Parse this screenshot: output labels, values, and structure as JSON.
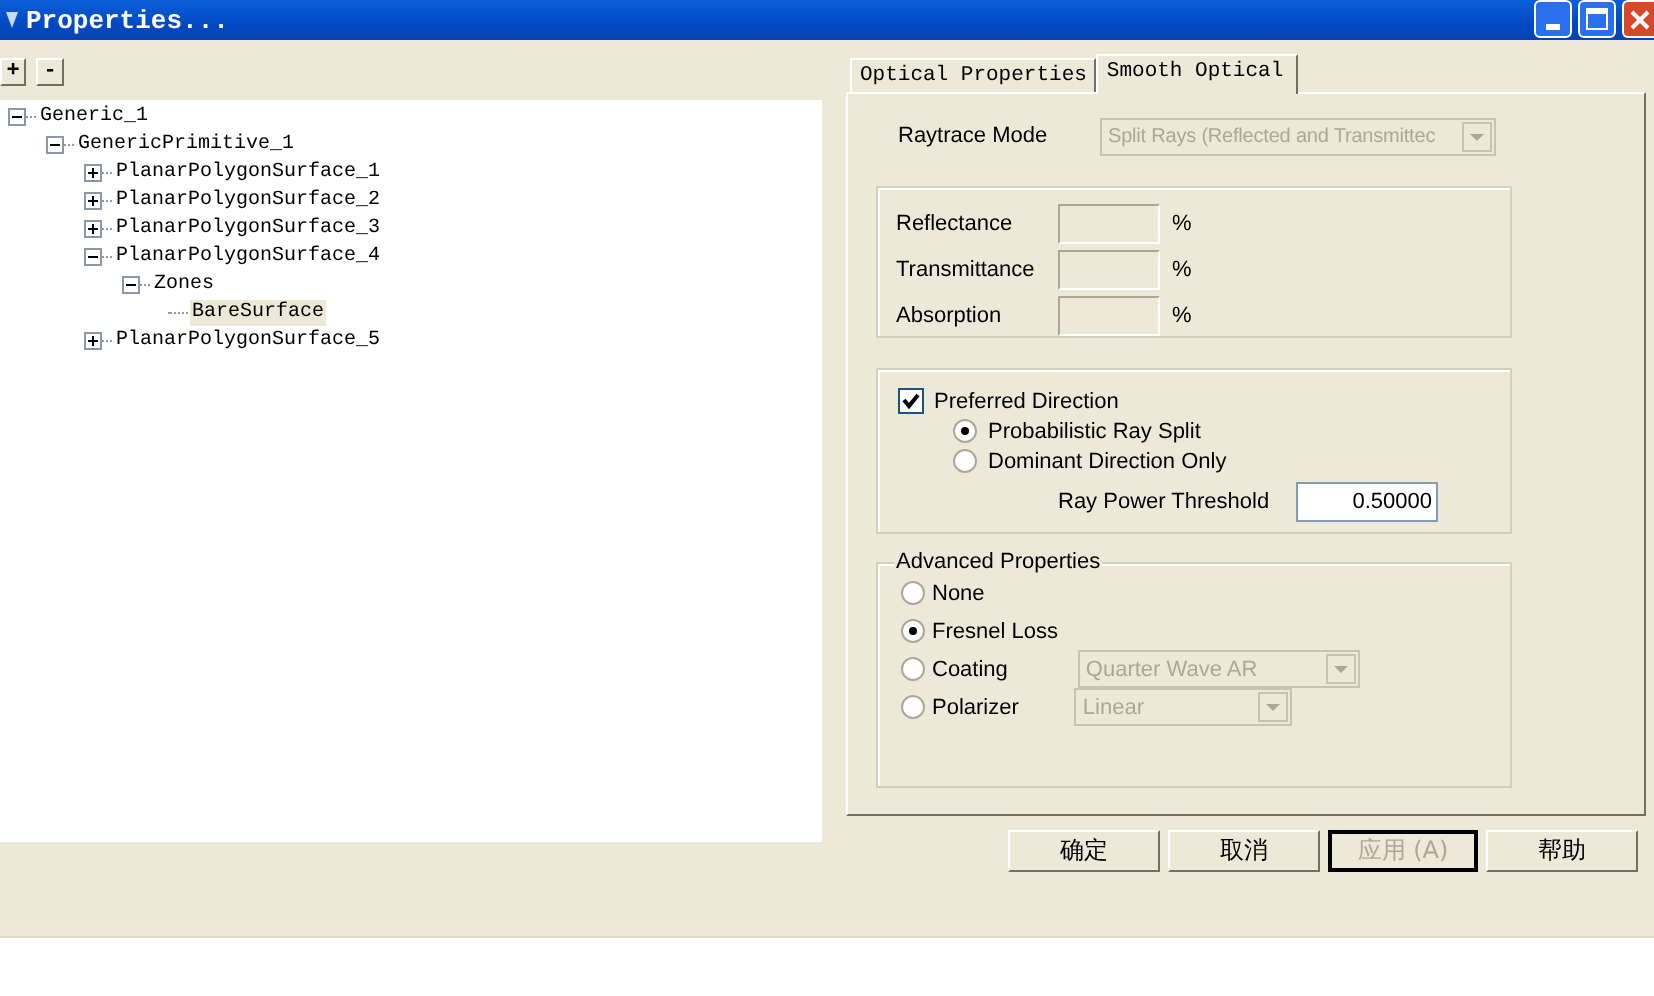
{
  "window": {
    "title": "Properties..."
  },
  "tree_buttons": [
    "+",
    "-"
  ],
  "tree": [
    {
      "label": "Generic_1",
      "kind": "node",
      "expanded": true,
      "selected": false,
      "children": [
        {
          "label": "GenericPrimitive_1",
          "kind": "node",
          "expanded": true,
          "selected": false,
          "children": [
            {
              "label": "PlanarPolygonSurface_1",
              "kind": "node",
              "expanded": false,
              "selected": false
            },
            {
              "label": "PlanarPolygonSurface_2",
              "kind": "node",
              "expanded": false,
              "selected": false
            },
            {
              "label": "PlanarPolygonSurface_3",
              "kind": "node",
              "expanded": false,
              "selected": false
            },
            {
              "label": "PlanarPolygonSurface_4",
              "kind": "node",
              "expanded": true,
              "selected": false,
              "children": [
                {
                  "label": "Zones",
                  "kind": "node",
                  "expanded": true,
                  "selected": false,
                  "children": [
                    {
                      "label": "BareSurface",
                      "kind": "leaf",
                      "selected": true
                    }
                  ]
                }
              ]
            },
            {
              "label": "PlanarPolygonSurface_5",
              "kind": "node",
              "expanded": false,
              "selected": false
            }
          ]
        }
      ]
    }
  ],
  "tabs": [
    {
      "label": "Optical Properties",
      "selected": false
    },
    {
      "label": "Smooth Optical",
      "selected": true
    }
  ],
  "raytrace_mode": {
    "label": "Raytrace Mode",
    "value": "Split Rays (Reflected and Transmittec",
    "disabled": true
  },
  "coefficients": [
    {
      "label": "Reflectance",
      "unit": "%"
    },
    {
      "label": "Transmittance",
      "unit": "%"
    },
    {
      "label": "Absorption",
      "unit": "%"
    }
  ],
  "preferred_direction": {
    "label": "Preferred Direction",
    "checked": true,
    "options": [
      {
        "label": "Probabilistic Ray Split",
        "selected": true
      },
      {
        "label": "Dominant Direction Only",
        "selected": false
      }
    ],
    "threshold": {
      "label": "Ray Power Threshold",
      "value": "0.50000"
    }
  },
  "advanced": {
    "title": "Advanced Properties",
    "options": [
      {
        "label": "None",
        "selected": false
      },
      {
        "label": "Fresnel Loss",
        "selected": true
      },
      {
        "label": "Coating",
        "selected": false,
        "dropdown": {
          "value": "Quarter Wave AR",
          "disabled": true
        }
      },
      {
        "label": "Polarizer",
        "selected": false,
        "dropdown": {
          "value": "Linear",
          "disabled": true
        }
      }
    ]
  },
  "buttons": [
    {
      "label": "确定",
      "disabled": false,
      "focused": false
    },
    {
      "label": "取消",
      "disabled": false,
      "focused": false
    },
    {
      "label": "应用 (A)",
      "disabled": true,
      "focused": true
    },
    {
      "label": "帮助",
      "disabled": false,
      "focused": false
    }
  ]
}
